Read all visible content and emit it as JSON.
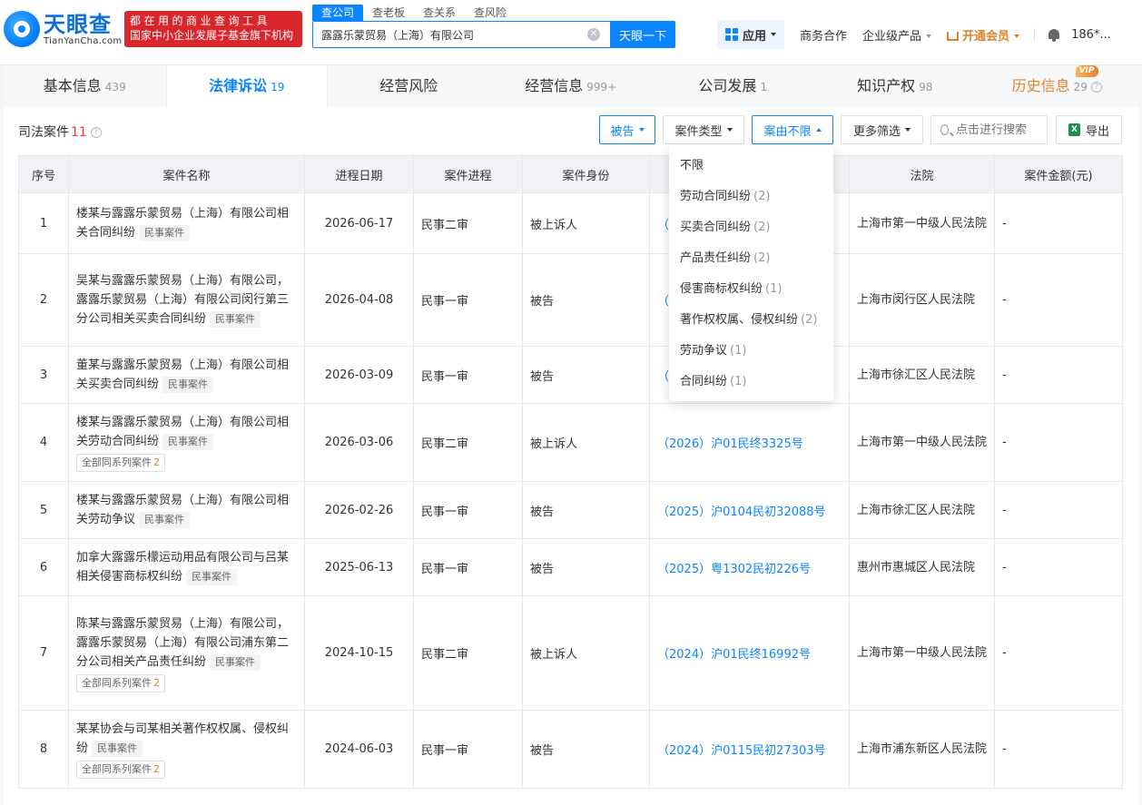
{
  "brand": {
    "name_cn": "天眼查",
    "name_en": "TianYanCha.com",
    "slogan_line1": "都在用的商业查询工具",
    "slogan_line2": "国家中小企业发展子基金旗下机构"
  },
  "search": {
    "tabs": [
      "查公司",
      "查老板",
      "查关系",
      "查风险"
    ],
    "value": "露露乐蒙贸易（上海）有限公司",
    "button": "天眼一下"
  },
  "nav": {
    "app": "应用",
    "business": "商务合作",
    "enterprise": "企业级产品",
    "vip": "开通会员",
    "user": "186*..."
  },
  "tabs": [
    {
      "label": "基本信息",
      "count": "439"
    },
    {
      "label": "法律诉讼",
      "count": "19"
    },
    {
      "label": "经营风险",
      "count": ""
    },
    {
      "label": "经营信息",
      "count": "999+"
    },
    {
      "label": "公司发展",
      "count": "1"
    },
    {
      "label": "知识产权",
      "count": "98"
    },
    {
      "label": "历史信息",
      "count": "29",
      "badge": "VIP"
    }
  ],
  "section": {
    "title": "司法案件",
    "count": "11"
  },
  "filters": {
    "defendant": "被告",
    "case_type": "案件类型",
    "cause": "案由不限",
    "more": "更多筛选",
    "search_placeholder": "点击进行搜索",
    "export": "导出"
  },
  "columns": [
    "序号",
    "案件名称",
    "进程日期",
    "案件进程",
    "案件身份",
    "案号",
    "法院",
    "案件金额(元)"
  ],
  "rows": [
    {
      "no": "1",
      "name": "楼某与露露乐蒙贸易（上海）有限公司相关合同纠纷",
      "tag": "民事案件",
      "series": "",
      "date": "2026-06-17",
      "stage": "民事二审",
      "role": "被上诉人",
      "case_no": "（",
      "court": "上海市第一中级人民法院",
      "amount": "-"
    },
    {
      "no": "2",
      "name": "吴某与露露乐蒙贸易（上海）有限公司，露露乐蒙贸易（上海）有限公司闵行第三分公司相关买卖合同纠纷",
      "tag": "民事案件",
      "series": "",
      "date": "2026-04-08",
      "stage": "民事一审",
      "role": "被告",
      "case_no": "（",
      "court": "上海市闵行区人民法院",
      "amount": "-"
    },
    {
      "no": "3",
      "name": "董某与露露乐蒙贸易（上海）有限公司相关买卖合同纠纷",
      "tag": "民事案件",
      "series": "",
      "date": "2026-03-09",
      "stage": "民事一审",
      "role": "被告",
      "case_no": "（",
      "court": "上海市徐汇区人民法院",
      "amount": "-"
    },
    {
      "no": "4",
      "name": "楼某与露露乐蒙贸易（上海）有限公司相关劳动合同纠纷",
      "tag": "民事案件",
      "series": "全部同系列案件",
      "series_n": "2",
      "date": "2026-03-06",
      "stage": "民事二审",
      "role": "被上诉人",
      "case_no": "（2026）沪01民终3325号",
      "court": "上海市第一中级人民法院",
      "amount": "-"
    },
    {
      "no": "5",
      "name": "楼某与露露乐蒙贸易（上海）有限公司相关劳动争议",
      "tag": "民事案件",
      "series": "",
      "date": "2026-02-26",
      "stage": "民事一审",
      "role": "被告",
      "case_no": "（2025）沪0104民初32088号",
      "court": "上海市徐汇区人民法院",
      "amount": "-"
    },
    {
      "no": "6",
      "name": "加拿大露露乐檬运动用品有限公司与吕某相关侵害商标权纠纷",
      "tag": "民事案件",
      "series": "",
      "date": "2025-06-13",
      "stage": "民事一审",
      "role": "被告",
      "case_no": "（2025）粤1302民初226号",
      "court": "惠州市惠城区人民法院",
      "amount": "-"
    },
    {
      "no": "7",
      "name": "陈某与露露乐蒙贸易（上海）有限公司，露露乐蒙贸易（上海）有限公司浦东第二分公司相关产品责任纠纷",
      "tag": "民事案件",
      "series": "全部同系列案件",
      "series_n": "2",
      "date": "2024-10-15",
      "stage": "民事二审",
      "role": "被上诉人",
      "case_no": "（2024）沪01民终16992号",
      "court": "上海市第一中级人民法院",
      "amount": "-"
    },
    {
      "no": "8",
      "name": "某某协会与司某相关著作权权属、侵权纠纷",
      "tag": "民事案件",
      "series": "全部同系列案件",
      "series_n": "2",
      "date": "2024-06-03",
      "stage": "民事一审",
      "role": "被告",
      "case_no": "（2024）沪0115民初27303号",
      "court": "上海市浦东新区人民法院",
      "amount": "-"
    }
  ],
  "dropdown": [
    {
      "label": "不限",
      "count": ""
    },
    {
      "label": "劳动合同纠纷",
      "count": "(2)"
    },
    {
      "label": "买卖合同纠纷",
      "count": "(2)"
    },
    {
      "label": "产品责任纠纷",
      "count": "(2)"
    },
    {
      "label": "侵害商标权纠纷",
      "count": "(1)"
    },
    {
      "label": "著作权权属、侵权纠纷",
      "count": "(2)"
    },
    {
      "label": "劳动争议",
      "count": "(1)"
    },
    {
      "label": "合同纠纷",
      "count": "(1)"
    }
  ]
}
